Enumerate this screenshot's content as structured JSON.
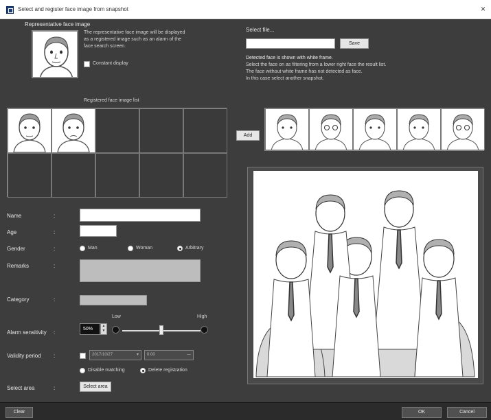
{
  "window": {
    "title": "Select and register face image from snapshot",
    "close_glyph": "×"
  },
  "representative": {
    "heading": "Representative face image",
    "desc_line1": "The representative face image will be displayed",
    "desc_line2": "as a registered image such as an alarm of the",
    "desc_line3": "face search screen.",
    "constant_display_label": "Constant display"
  },
  "select_file": {
    "label": "Select file...",
    "value": "",
    "browse_label": "Save"
  },
  "instructions": {
    "line1": "Detected face is shown with white frame.",
    "line2": "Select the face on as filtering from a lower right face the result list.",
    "line3": "The face without white frame has not detected as face.",
    "line4": "In this case select another snapshot."
  },
  "registered_list": {
    "heading": "Registered face image list"
  },
  "add_button": "Add",
  "form": {
    "name_label": "Name",
    "name_value": "",
    "age_label": "Age",
    "age_value": "",
    "gender_label": "Gender",
    "gender_options": [
      "Man",
      "Woman",
      "Arbitrary"
    ],
    "gender_selected": "Arbitrary",
    "remarks_label": "Remarks",
    "category_label": "Category",
    "alarm_sensitivity_label": "Alarm sensitivity",
    "sensitivity_value": "50%",
    "sensitivity_fraction": 0.5,
    "sensitivity_low_label": "Low",
    "sensitivity_high_label": "High",
    "validity_period_label": "Validity period",
    "validity_date": "2017/10/27",
    "validity_time": "0:00",
    "after_expiry_options": [
      "Disable matching",
      "Delete registration"
    ],
    "after_expiry_selected": "Delete registration",
    "select_area_label": "Select area",
    "select_area_button": "Select area",
    "colon": ":"
  },
  "footer": {
    "clear_label": "Clear",
    "ok_label": "OK",
    "cancel_label": "Cancel"
  },
  "icons": {
    "app": "app-window-icon",
    "close": "close-icon",
    "calendar": "calendar-icon",
    "spin": "spin-arrows-icon"
  }
}
